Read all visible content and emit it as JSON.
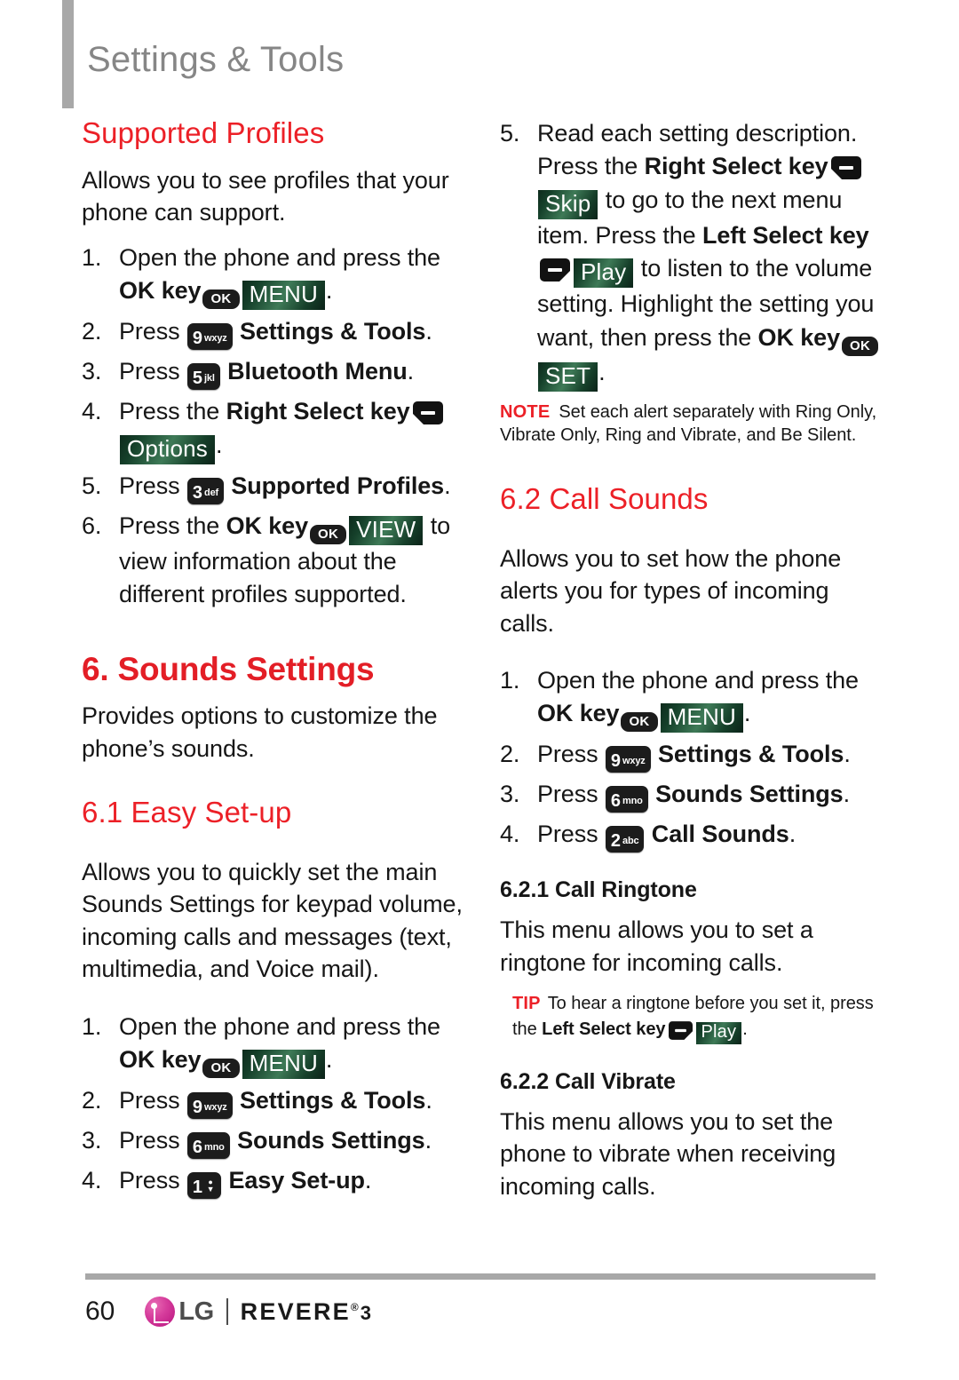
{
  "page": {
    "header_title": "Settings & Tools",
    "page_number": "60",
    "brand": {
      "lg": "LG",
      "model": "REVERE",
      "registered": "®",
      "version": "3"
    }
  },
  "colors": {
    "heading_red": "#ec2027",
    "chapter_red": "#e31e26",
    "header_gray": "#868686",
    "rule_gray": "#a8a8a8",
    "badge_green": "#3e7a57",
    "key_black": "#1c1c1c",
    "lg_magenta": "#d63d9c"
  },
  "keys": {
    "ok": "OK",
    "k1": {
      "digit": "1",
      "letters": "voicemail"
    },
    "k2": {
      "digit": "2",
      "letters": "abc"
    },
    "k3": {
      "digit": "3",
      "letters": "def"
    },
    "k5": {
      "digit": "5",
      "letters": "jkl"
    },
    "k6": {
      "digit": "6",
      "letters": "mno"
    },
    "k9": {
      "digit": "9",
      "letters": "wxyz"
    }
  },
  "badges": {
    "menu": "MENU",
    "options": "Options",
    "view": "VIEW",
    "skip": "Skip",
    "play": "Play",
    "set": "SET"
  },
  "left_column": {
    "supported_profiles": {
      "heading": "Supported Profiles",
      "intro": "Allows you to see profiles that your phone can support.",
      "steps": [
        {
          "num": "1.",
          "parts": [
            {
              "t": "text",
              "v": "Open the phone and press the "
            },
            {
              "t": "bold",
              "v": "OK key"
            },
            {
              "t": "key-ok"
            },
            {
              "t": "badge",
              "v": "MENU"
            },
            {
              "t": "text",
              "v": "."
            }
          ]
        },
        {
          "num": "2.",
          "parts": [
            {
              "t": "text",
              "v": "Press "
            },
            {
              "t": "key-pad",
              "v": "k9"
            },
            {
              "t": "bold",
              "v": " Settings & Tools"
            },
            {
              "t": "text",
              "v": "."
            }
          ]
        },
        {
          "num": "3.",
          "parts": [
            {
              "t": "text",
              "v": "Press "
            },
            {
              "t": "key-pad",
              "v": "k5"
            },
            {
              "t": "bold",
              "v": " Bluetooth Menu"
            },
            {
              "t": "text",
              "v": "."
            }
          ]
        },
        {
          "num": "4.",
          "parts": [
            {
              "t": "text",
              "v": "Press the "
            },
            {
              "t": "bold",
              "v": "Right Select key"
            },
            {
              "t": "key-right"
            },
            {
              "t": "badge",
              "v": "Options"
            },
            {
              "t": "text",
              "v": "."
            }
          ]
        },
        {
          "num": "5.",
          "parts": [
            {
              "t": "text",
              "v": "Press "
            },
            {
              "t": "key-pad",
              "v": "k3"
            },
            {
              "t": "bold",
              "v": " Supported Profiles"
            },
            {
              "t": "text",
              "v": "."
            }
          ]
        },
        {
          "num": "6.",
          "parts": [
            {
              "t": "text",
              "v": "Press the "
            },
            {
              "t": "bold",
              "v": "OK key"
            },
            {
              "t": "key-ok"
            },
            {
              "t": "badge",
              "v": "VIEW"
            },
            {
              "t": "text",
              "v": " to view information about the different profiles supported."
            }
          ]
        }
      ]
    },
    "chapter": {
      "title": "6. Sounds Settings",
      "intro": "Provides options to customize the phone’s sounds."
    },
    "easy_setup": {
      "heading": "6.1 Easy Set-up",
      "intro": "Allows you to quickly set the main Sounds Settings for keypad volume, incoming calls and messages (text, multimedia, and Voice mail).",
      "steps": [
        {
          "num": "1.",
          "parts": [
            {
              "t": "text",
              "v": "Open the phone and press the "
            },
            {
              "t": "bold",
              "v": "OK key"
            },
            {
              "t": "key-ok"
            },
            {
              "t": "badge",
              "v": "MENU"
            },
            {
              "t": "text",
              "v": "."
            }
          ]
        },
        {
          "num": "2.",
          "parts": [
            {
              "t": "text",
              "v": "Press "
            },
            {
              "t": "key-pad",
              "v": "k9"
            },
            {
              "t": "bold",
              "v": " Settings & Tools"
            },
            {
              "t": "text",
              "v": "."
            }
          ]
        },
        {
          "num": "3.",
          "parts": [
            {
              "t": "text",
              "v": "Press "
            },
            {
              "t": "key-pad",
              "v": "k6"
            },
            {
              "t": "bold",
              "v": " Sounds Settings"
            },
            {
              "t": "text",
              "v": "."
            }
          ]
        },
        {
          "num": "4.",
          "parts": [
            {
              "t": "text",
              "v": "Press "
            },
            {
              "t": "key-pad",
              "v": "k1"
            },
            {
              "t": "bold",
              "v": " Easy Set-up"
            },
            {
              "t": "text",
              "v": "."
            }
          ]
        }
      ]
    }
  },
  "right_column": {
    "easy_setup_step5": {
      "num": "5.",
      "parts": [
        {
          "t": "text",
          "v": "Read each setting description. Press the "
        },
        {
          "t": "bold",
          "v": "Right Select key"
        },
        {
          "t": "key-right"
        },
        {
          "t": "badge",
          "v": "Skip"
        },
        {
          "t": "text",
          "v": " to go to the next menu item. Press the "
        },
        {
          "t": "bold",
          "v": "Left Select key"
        },
        {
          "t": "key-left"
        },
        {
          "t": "badge",
          "v": "Play"
        },
        {
          "t": "text",
          "v": " to listen to the volume setting. Highlight the setting you want, then press the "
        },
        {
          "t": "bold",
          "v": "OK key"
        },
        {
          "t": "key-ok"
        },
        {
          "t": "badge",
          "v": "SET"
        },
        {
          "t": "text",
          "v": "."
        }
      ]
    },
    "note": {
      "label": "NOTE",
      "text": "Set each alert separately with Ring Only, Vibrate Only, Ring and Vibrate, and Be Silent."
    },
    "call_sounds": {
      "heading": "6.2 Call Sounds",
      "intro": "Allows you to set how the phone alerts you for types of incoming calls.",
      "steps": [
        {
          "num": "1.",
          "parts": [
            {
              "t": "text",
              "v": "Open the phone and press the "
            },
            {
              "t": "bold",
              "v": "OK key"
            },
            {
              "t": "key-ok"
            },
            {
              "t": "badge",
              "v": "MENU"
            },
            {
              "t": "text",
              "v": "."
            }
          ]
        },
        {
          "num": "2.",
          "parts": [
            {
              "t": "text",
              "v": "Press "
            },
            {
              "t": "key-pad",
              "v": "k9"
            },
            {
              "t": "bold",
              "v": " Settings & Tools"
            },
            {
              "t": "text",
              "v": "."
            }
          ]
        },
        {
          "num": "3.",
          "parts": [
            {
              "t": "text",
              "v": "Press "
            },
            {
              "t": "key-pad",
              "v": "k6"
            },
            {
              "t": "bold",
              "v": " Sounds Settings"
            },
            {
              "t": "text",
              "v": "."
            }
          ]
        },
        {
          "num": "4.",
          "parts": [
            {
              "t": "text",
              "v": "Press "
            },
            {
              "t": "key-pad",
              "v": "k2"
            },
            {
              "t": "bold",
              "v": " Call Sounds"
            },
            {
              "t": "text",
              "v": "."
            }
          ]
        }
      ]
    },
    "call_ringtone": {
      "heading": "6.2.1 Call Ringtone",
      "intro": "This menu allows you to set a ringtone for incoming calls.",
      "tip": {
        "label": "TIP",
        "parts": [
          {
            "t": "text",
            "v": "To hear a ringtone before you set it, press the "
          },
          {
            "t": "bold",
            "v": "Left Select key"
          },
          {
            "t": "key-left-sm"
          },
          {
            "t": "badge-sm",
            "v": "Play"
          },
          {
            "t": "text",
            "v": "."
          }
        ]
      }
    },
    "call_vibrate": {
      "heading": "6.2.2 Call Vibrate",
      "intro": "This menu allows you to set the phone to vibrate when receiving incoming calls."
    }
  }
}
